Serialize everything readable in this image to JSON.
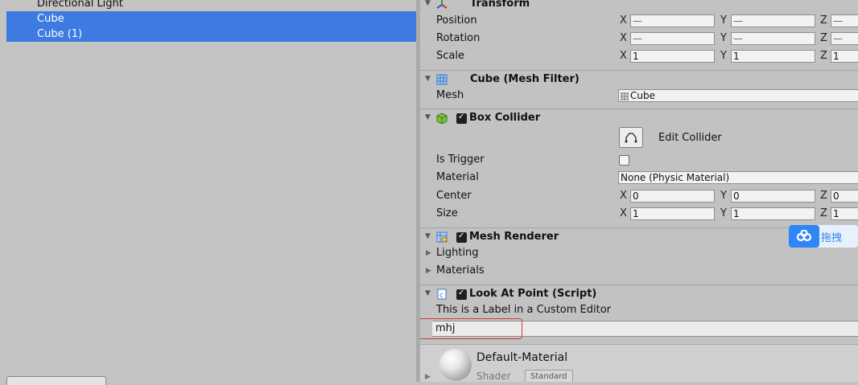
{
  "hierarchy": {
    "items": [
      {
        "label": "Directional Light",
        "selected": false
      },
      {
        "label": "Cube",
        "selected": true
      },
      {
        "label": "Cube (1)",
        "selected": true
      }
    ]
  },
  "transform": {
    "title": "Transform",
    "rows": [
      {
        "label": "Position",
        "x": "—",
        "y": "—",
        "z": "—"
      },
      {
        "label": "Rotation",
        "x": "—",
        "y": "—",
        "z": "—"
      },
      {
        "label": "Scale",
        "x": "1",
        "y": "1",
        "z": "1"
      }
    ],
    "axis": {
      "x": "X",
      "y": "Y",
      "z": "Z"
    }
  },
  "mesh_filter": {
    "title": "Cube (Mesh Filter)",
    "mesh_label": "Mesh",
    "mesh_value": "Cube"
  },
  "box_collider": {
    "title": "Box Collider",
    "enabled": true,
    "edit_label": "Edit Collider",
    "is_trigger_label": "Is Trigger",
    "material_label": "Material",
    "material_value": "None (Physic Material)",
    "center_label": "Center",
    "center": {
      "x": "0",
      "y": "0",
      "z": "0"
    },
    "size_label": "Size",
    "size": {
      "x": "1",
      "y": "1",
      "z": "1"
    }
  },
  "mesh_renderer": {
    "title": "Mesh Renderer",
    "enabled": true,
    "lighting_label": "Lighting",
    "materials_label": "Materials"
  },
  "look_at_point": {
    "title": "Look At Point (Script)",
    "enabled": true,
    "custom_label": "This is a Label in a Custom Editor",
    "text_value": "mhj"
  },
  "overlay_badge": {
    "text": "拖拽"
  },
  "material": {
    "name": "Default-Material",
    "shader_label": "Shader",
    "shader_value": "Standard"
  },
  "colors": {
    "selection": "#3d7be0",
    "highlight": "#d23a3a",
    "badge": "#2f86f6"
  }
}
